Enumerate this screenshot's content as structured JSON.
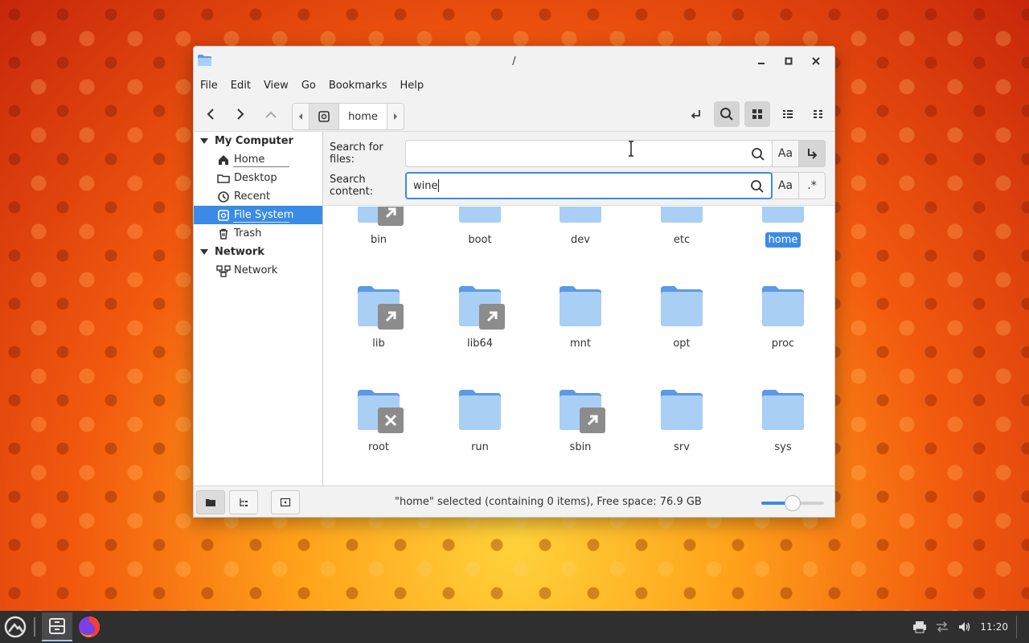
{
  "window": {
    "title": "/",
    "menu": [
      "File",
      "Edit",
      "View",
      "Go",
      "Bookmarks",
      "Help"
    ]
  },
  "pathbar": {
    "crumb": "home"
  },
  "sidebar": {
    "sections": [
      {
        "heading": "My Computer",
        "items": [
          "Home",
          "Desktop",
          "Recent",
          "File System",
          "Trash"
        ]
      },
      {
        "heading": "Network",
        "items": [
          "Network"
        ]
      }
    ],
    "selected": "File System"
  },
  "search": {
    "files_label": "Search for files:",
    "files_value": "",
    "content_label": "Search content:",
    "content_value": "wine",
    "case_btn": "Aa",
    "regex_btn": ".*"
  },
  "files": [
    {
      "name": "bin",
      "badge": "link"
    },
    {
      "name": "boot",
      "badge": ""
    },
    {
      "name": "dev",
      "badge": ""
    },
    {
      "name": "etc",
      "badge": ""
    },
    {
      "name": "home",
      "badge": "",
      "selected": true
    },
    {
      "name": "lib",
      "badge": "link"
    },
    {
      "name": "lib64",
      "badge": "link"
    },
    {
      "name": "mnt",
      "badge": ""
    },
    {
      "name": "opt",
      "badge": ""
    },
    {
      "name": "proc",
      "badge": ""
    },
    {
      "name": "root",
      "badge": "locked"
    },
    {
      "name": "run",
      "badge": ""
    },
    {
      "name": "sbin",
      "badge": "link"
    },
    {
      "name": "srv",
      "badge": ""
    },
    {
      "name": "sys",
      "badge": ""
    }
  ],
  "status": {
    "text": "\"home\" selected (containing 0 items), Free space: 76.9 GB",
    "zoom_fraction": 0.5
  },
  "taskbar": {
    "clock": "11:20"
  },
  "colors": {
    "accent": "#3b8be6",
    "folder": "#a9cff5",
    "folder_tab": "#5a9ae6"
  }
}
